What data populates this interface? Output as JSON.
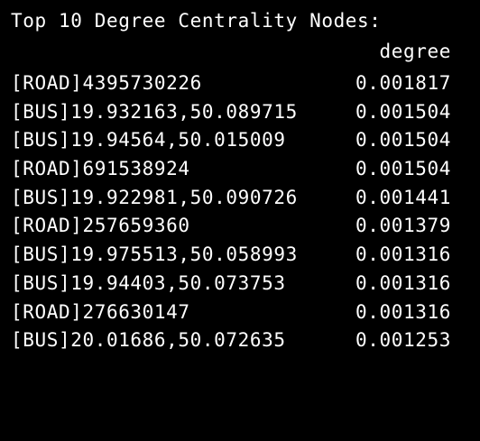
{
  "terminal": {
    "heading": "Top 10 Degree Centrality Nodes:",
    "column_header": "degree",
    "rows": [
      {
        "node": "[ROAD]4395730226",
        "degree": "0.001817"
      },
      {
        "node": "[BUS]19.932163,50.089715",
        "degree": "0.001504"
      },
      {
        "node": "[BUS]19.94564,50.015009",
        "degree": "0.001504"
      },
      {
        "node": "[ROAD]691538924",
        "degree": "0.001504"
      },
      {
        "node": "[BUS]19.922981,50.090726",
        "degree": "0.001441"
      },
      {
        "node": "[ROAD]257659360",
        "degree": "0.001379"
      },
      {
        "node": "[BUS]19.975513,50.058993",
        "degree": "0.001316"
      },
      {
        "node": "[BUS]19.94403,50.073753",
        "degree": "0.001316"
      },
      {
        "node": "[ROAD]276630147",
        "degree": "0.001316"
      },
      {
        "node": "[BUS]20.01686,50.072635",
        "degree": "0.001253"
      }
    ]
  },
  "colors": {
    "background": "#000000",
    "text": "#ffffff"
  }
}
